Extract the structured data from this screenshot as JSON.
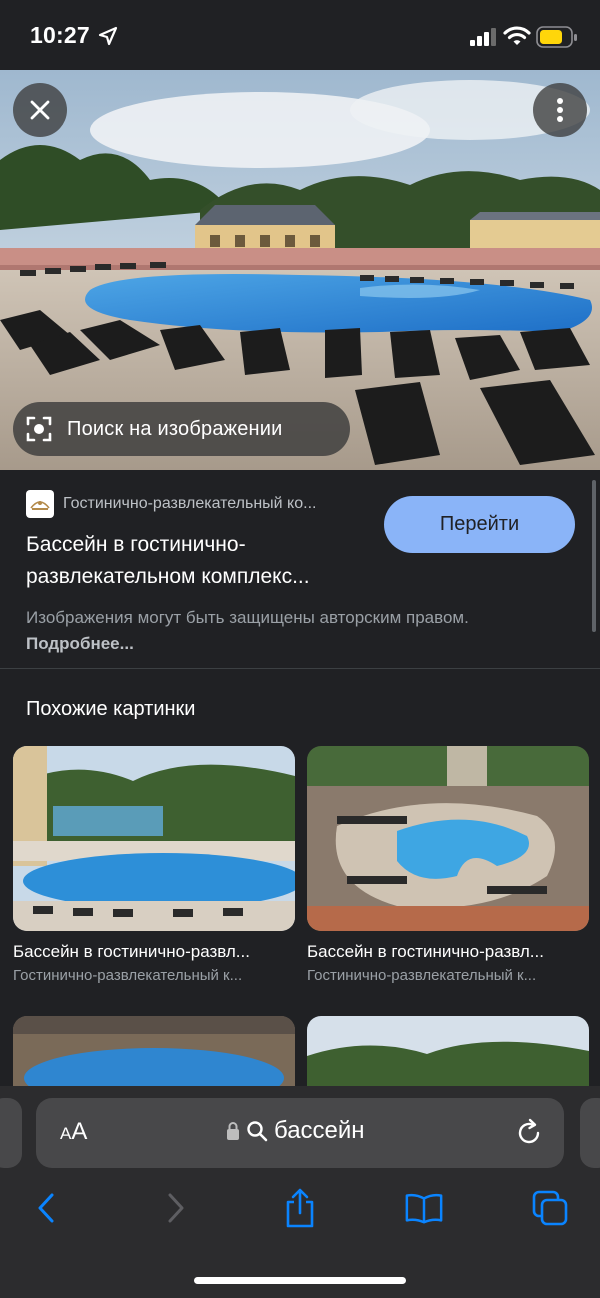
{
  "status": {
    "time": "10:27"
  },
  "hero": {
    "lens_label": "Поиск на изображении",
    "close_icon": "close-icon",
    "more_icon": "more-vert-icon"
  },
  "result": {
    "source_name": "Гостинично-развлекательный ко...",
    "title": "Бассейн в гостинично-развлекательном комплекс...",
    "go_label": "Перейти",
    "copyright_text": "Изображения могут быть защищены авторским правом.",
    "copyright_link": "Подробнее..."
  },
  "similar": {
    "heading": "Похожие картинки",
    "items": [
      {
        "title": "Бассейн в гостинично-развл...",
        "source": "Гостинично-развлекательный к..."
      },
      {
        "title": "Бассейн в гостинично-развл...",
        "source": "Гостинично-развлекательный к..."
      }
    ]
  },
  "browser": {
    "aa_small": "A",
    "aa_large": "A",
    "url_text": "бассейн",
    "colors": {
      "accent": "#8ab4f8",
      "link": "#0a84ff",
      "toolbar": "#2c2c2e"
    }
  }
}
